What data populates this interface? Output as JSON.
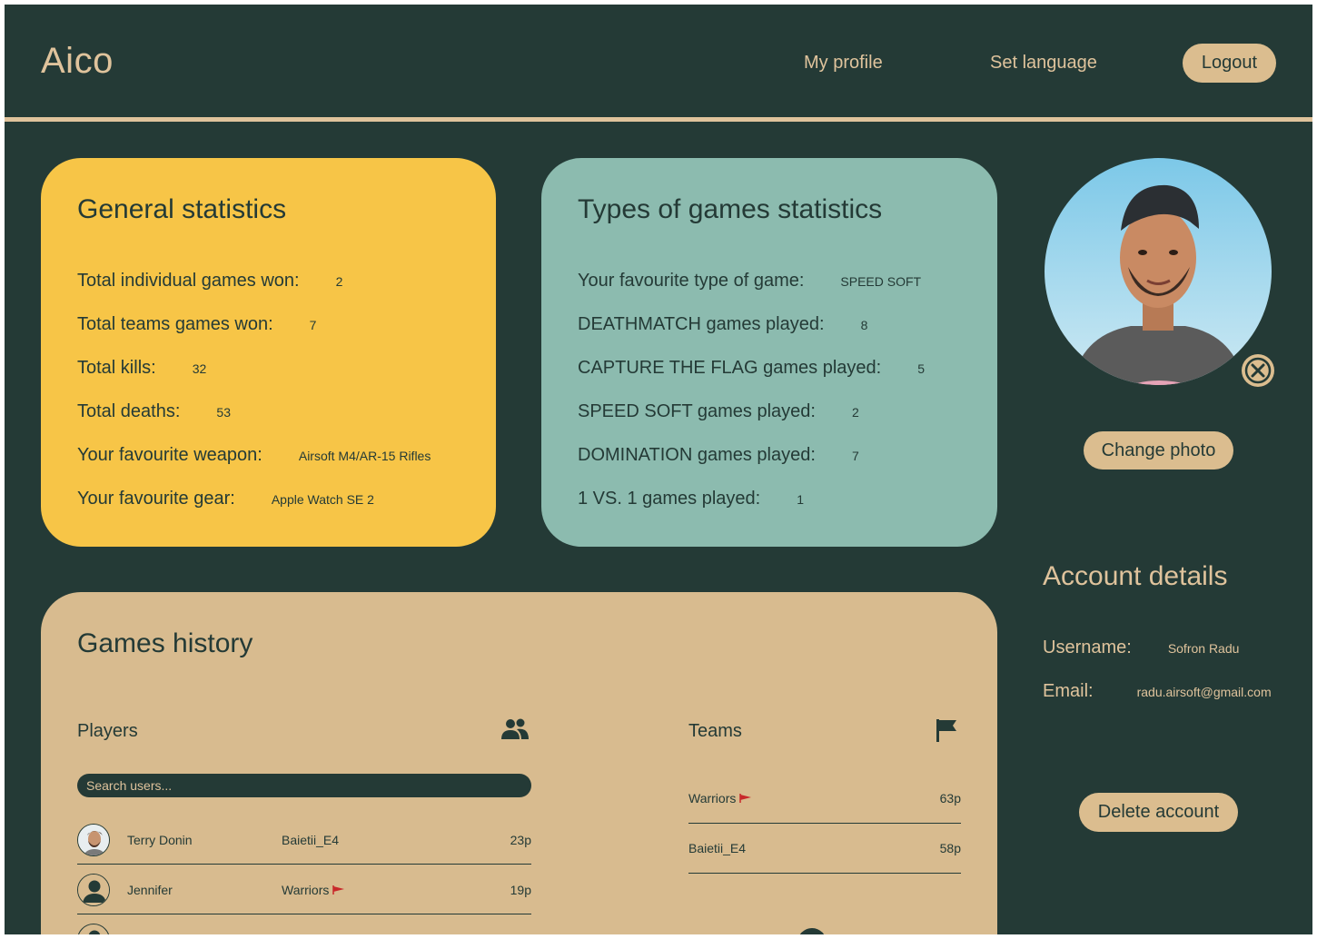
{
  "header": {
    "logo": "Aico",
    "nav": {
      "profile": "My profile",
      "language": "Set language"
    },
    "logout": "Logout"
  },
  "general": {
    "title": "General statistics",
    "rows": [
      {
        "label": "Total individual games won:",
        "value": "2"
      },
      {
        "label": "Total teams games won:",
        "value": "7"
      },
      {
        "label": "Total kills:",
        "value": "32"
      },
      {
        "label": "Total deaths:",
        "value": "53"
      },
      {
        "label": "Your favourite weapon:",
        "value": "Airsoft M4/AR-15 Rifles"
      },
      {
        "label": "Your favourite gear:",
        "value": "Apple Watch SE 2"
      }
    ]
  },
  "types": {
    "title": "Types of games statistics",
    "rows": [
      {
        "label": "Your favourite type of game:",
        "value": "SPEED SOFT"
      },
      {
        "label": "DEATHMATCH games played:",
        "value": "8"
      },
      {
        "label": "CAPTURE THE FLAG games played:",
        "value": "5"
      },
      {
        "label": "SPEED SOFT games played:",
        "value": "2"
      },
      {
        "label": "DOMINATION games played:",
        "value": "7"
      },
      {
        "label": "1 VS. 1 games played:",
        "value": "1"
      }
    ]
  },
  "profile": {
    "change_photo": "Change photo"
  },
  "account": {
    "title": "Account details",
    "username_label": "Username:",
    "username": "Sofron Radu",
    "email_label": "Email:",
    "email": "radu.airsoft@gmail.com",
    "delete": "Delete account"
  },
  "history": {
    "title": "Games history",
    "players_title": "Players",
    "teams_title": "Teams",
    "search_placeholder": "Search users...",
    "players": [
      {
        "name": "Terry Donin",
        "team": "Baietii_E4",
        "points": "23p"
      },
      {
        "name": "Jennifer",
        "team": "Warriors",
        "points": "19p"
      }
    ],
    "teams": [
      {
        "name": "Warriors",
        "points": "63p"
      },
      {
        "name": "Baietii_E4",
        "points": "58p"
      }
    ]
  },
  "colors": {
    "background": "#243a36",
    "accent": "#dfc39c",
    "general_card": "#f7c547",
    "types_card": "#8cbbaf",
    "history_card": "#d8bb8f",
    "flag": "#c8282a"
  },
  "icons": [
    "close-icon",
    "people-icon",
    "flag-icon",
    "user-icon"
  ]
}
